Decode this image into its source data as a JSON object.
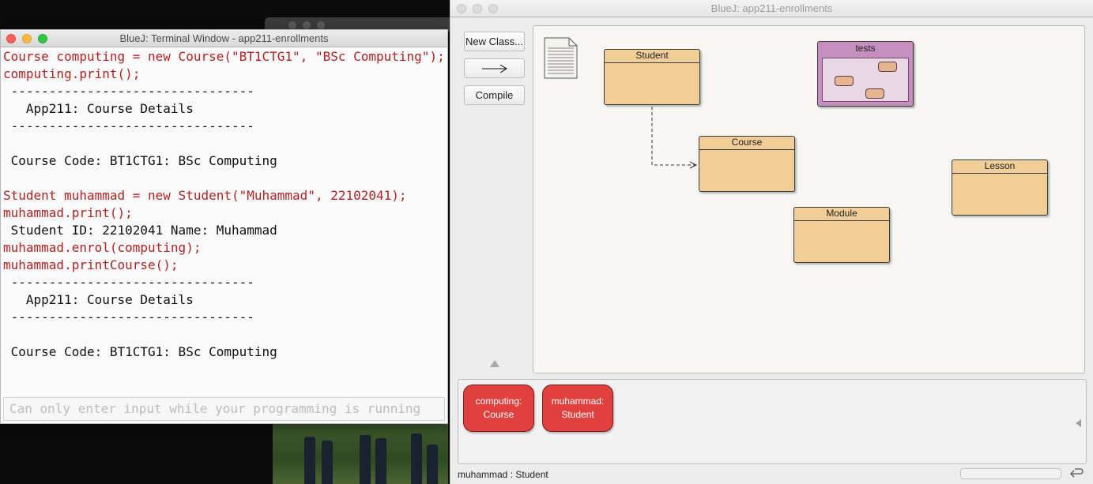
{
  "terminal": {
    "title": "BlueJ: Terminal Window - app211-enrollments",
    "lines": [
      {
        "kind": "code",
        "text": "Course computing = new Course(\"BT1CTG1\", \"BSc Computing\");"
      },
      {
        "kind": "code",
        "text": "computing.print();"
      },
      {
        "kind": "out",
        "text": " --------------------------------"
      },
      {
        "kind": "out",
        "text": "   App211: Course Details"
      },
      {
        "kind": "out",
        "text": " --------------------------------"
      },
      {
        "kind": "out",
        "text": ""
      },
      {
        "kind": "out",
        "text": " Course Code: BT1CTG1: BSc Computing"
      },
      {
        "kind": "out",
        "text": ""
      },
      {
        "kind": "code",
        "text": "Student muhammad = new Student(\"Muhammad\", 22102041);"
      },
      {
        "kind": "code",
        "text": "muhammad.print();"
      },
      {
        "kind": "out",
        "text": " Student ID: 22102041 Name: Muhammad"
      },
      {
        "kind": "code",
        "text": "muhammad.enrol(computing);"
      },
      {
        "kind": "code",
        "text": "muhammad.printCourse();"
      },
      {
        "kind": "out",
        "text": " --------------------------------"
      },
      {
        "kind": "out",
        "text": "   App211: Course Details"
      },
      {
        "kind": "out",
        "text": " --------------------------------"
      },
      {
        "kind": "out",
        "text": ""
      },
      {
        "kind": "out",
        "text": " Course Code: BT1CTG1: BSc Computing"
      }
    ],
    "input_placeholder": "Can only enter input while your programming is running"
  },
  "bluej": {
    "title": "BlueJ:  app211-enrollments",
    "toolbar": {
      "new_class_label": "New Class...",
      "compile_label": "Compile"
    },
    "classes": {
      "student": "Student",
      "course": "Course",
      "lesson": "Lesson",
      "module": "Module"
    },
    "package": {
      "name": "tests"
    },
    "objects": [
      {
        "name": "computing:",
        "type": "Course"
      },
      {
        "name": "muhammad:",
        "type": "Student"
      }
    ],
    "status": "muhammad : Student"
  },
  "colors": {
    "code_text": "#b22222",
    "class_fill": "#f1cd97",
    "package_fill": "#c48fbf",
    "object_fill": "#e0403e"
  }
}
